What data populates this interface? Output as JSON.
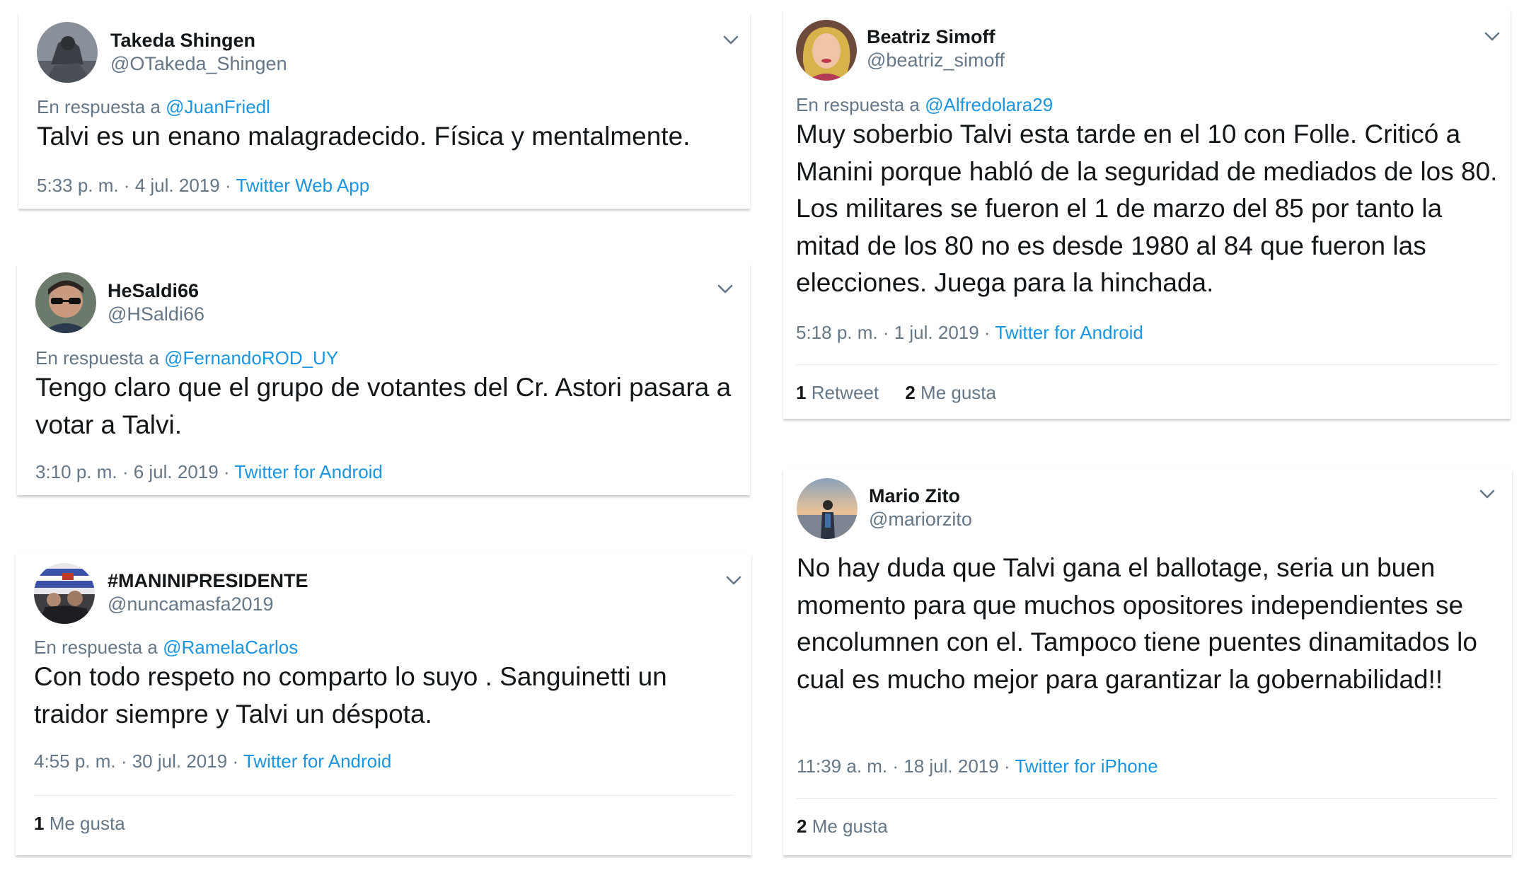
{
  "tweets": [
    {
      "name": "Takeda Shingen",
      "handle": "@OTakeda_Shingen",
      "reply_prefix": "En respuesta a",
      "reply_to": "@JuanFriedl",
      "text": "Talvi es un enano malagradecido. Física y mentalmente.",
      "time": "5:33 p. m. · 4 jul. 2019 ·",
      "source": "Twitter Web App"
    },
    {
      "name": "HeSaldi66",
      "handle": "@HSaldi66",
      "reply_prefix": "En respuesta a",
      "reply_to": "@FernandoROD_UY",
      "text": "Tengo claro que el grupo de votantes del Cr. Astori pasara a votar a Talvi.",
      "time": "3:10 p. m. · 6 jul. 2019 ·",
      "source": "Twitter for Android"
    },
    {
      "name": "#MANINIPRESIDENTE",
      "handle": "@nuncamasfa2019",
      "reply_prefix": "En respuesta a",
      "reply_to": "@RamelaCarlos",
      "text": "Con todo respeto no comparto lo suyo . Sanguinetti un traidor siempre y Talvi un déspota.",
      "time": "4:55 p. m. · 30 jul. 2019 ·",
      "source": "Twitter for Android",
      "likes_count": "1",
      "likes_label": "Me gusta"
    },
    {
      "name": "Beatriz Simoff",
      "handle": "@beatriz_simoff",
      "reply_prefix": "En respuesta a",
      "reply_to": "@Alfredolara29",
      "text": "Muy soberbio Talvi esta tarde en el 10 con Folle. Criticó a Manini porque habló de la seguridad de mediados de los 80. Los militares se fueron el 1 de marzo del 85 por tanto la mitad de los 80 no es desde 1980 al 84 que fueron las elecciones. Juega para la hinchada.",
      "time": "5:18 p. m. · 1 jul. 2019 ·",
      "source": "Twitter for Android",
      "retweets_count": "1",
      "retweets_label": "Retweet",
      "likes_count": "2",
      "likes_label": "Me gusta"
    },
    {
      "name": "Mario Zito",
      "handle": "@mariorzito",
      "text": "No hay duda que Talvi gana el ballotage, seria un buen momento para que muchos opositores independientes se encolumnen con el. Tampoco tiene puentes dinamitados lo cual es mucho mejor para garantizar la gobernabilidad!!",
      "time": "11:39 a. m. · 18 jul. 2019 ·",
      "source": "Twitter for iPhone",
      "likes_count": "2",
      "likes_label": "Me gusta"
    }
  ],
  "colors": {
    "link": "#1b95e0",
    "secondary_text": "#657786",
    "primary_text": "#14171a"
  },
  "icons": {
    "menu": "chevron-down-icon"
  }
}
